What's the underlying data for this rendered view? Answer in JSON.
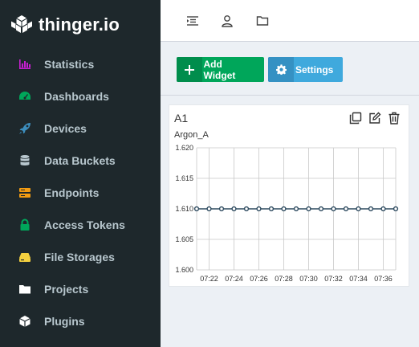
{
  "brand": {
    "name": "thinger.io"
  },
  "sidebar": {
    "items": [
      {
        "label": "Statistics",
        "icon": "bar-chart-icon",
        "color": "#c71fd1"
      },
      {
        "label": "Dashboards",
        "icon": "gauge-icon",
        "color": "#00a65a"
      },
      {
        "label": "Devices",
        "icon": "rocket-icon",
        "color": "#3c8dbc"
      },
      {
        "label": "Data Buckets",
        "icon": "database-icon",
        "color": "#b8c7ce"
      },
      {
        "label": "Endpoints",
        "icon": "server-icon",
        "color": "#f39c12"
      },
      {
        "label": "Access Tokens",
        "icon": "lock-icon",
        "color": "#00a65a"
      },
      {
        "label": "File Storages",
        "icon": "hdd-icon",
        "color": "#f4d03f"
      },
      {
        "label": "Projects",
        "icon": "folder-icon",
        "color": "#ffffff"
      },
      {
        "label": "Plugins",
        "icon": "cube-icon",
        "color": "#ffffff"
      }
    ]
  },
  "toolbar": {
    "add_widget_label": "Add Widget",
    "settings_label": "Settings"
  },
  "widget": {
    "title": "A1",
    "tools": [
      "copy-icon",
      "edit-icon",
      "trash-icon"
    ]
  },
  "chart_data": {
    "type": "line",
    "title": "",
    "series": [
      {
        "name": "Argon_A",
        "x": [
          "07:21",
          "07:22",
          "07:23",
          "07:24",
          "07:25",
          "07:26",
          "07:27",
          "07:28",
          "07:29",
          "07:30",
          "07:31",
          "07:32",
          "07:33",
          "07:34",
          "07:35",
          "07:36",
          "07:37"
        ],
        "values": [
          1.61,
          1.61,
          1.61,
          1.61,
          1.61,
          1.61,
          1.61,
          1.61,
          1.61,
          1.61,
          1.61,
          1.61,
          1.61,
          1.61,
          1.61,
          1.61,
          1.61
        ]
      }
    ],
    "ylim": [
      1.6,
      1.62
    ],
    "yticks": [
      "1.620",
      "1.615",
      "1.610",
      "1.605",
      "1.600"
    ],
    "xticks": [
      "07:22",
      "07:24",
      "07:26",
      "07:28",
      "07:30",
      "07:32",
      "07:34",
      "07:36"
    ],
    "grid": true,
    "legend": "top-left",
    "line_color": "#2d4a5f"
  }
}
